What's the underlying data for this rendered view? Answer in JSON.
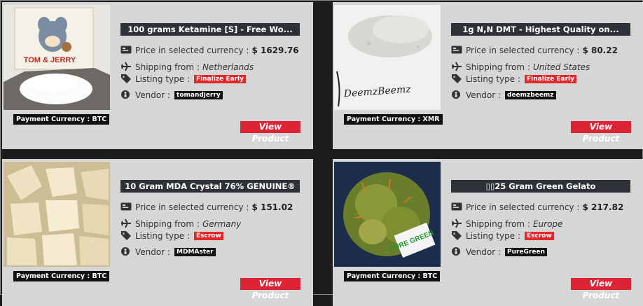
{
  "labels": {
    "price": "Price in selected currency :",
    "shipping": "Shipping from :",
    "listing": "Listing type :",
    "vendor": "Vendor :",
    "view": "View Product"
  },
  "products": [
    {
      "title": "100 grams Ketamine [S] - Free Wo...",
      "price": "$ 1629.76",
      "shipping_from": "Netherlands",
      "listing_type": "Finalize Early",
      "vendor": "tomandjerry",
      "payment": "Payment Currency : BTC",
      "image_logo_text": "TOM & JERRY"
    },
    {
      "title": "1g N,N DMT - Highest Quality on...",
      "price": "$ 80.22",
      "shipping_from": "United States",
      "listing_type": "Finalize Early",
      "vendor": "deemzbeemz",
      "payment": "Payment Currency : XMR",
      "image_logo_text": "DeemzBeemz"
    },
    {
      "title": "10 Gram MDA Crystal 76% GENUINE®",
      "price": "$ 151.02",
      "shipping_from": "Germany",
      "listing_type": "Escrow",
      "vendor": "MDMAster",
      "payment": "Payment Currency : BTC"
    },
    {
      "title": "▯▯25 Gram Green Gelato",
      "price": "$ 217.82",
      "shipping_from": "Europe",
      "listing_type": "Escrow",
      "vendor": "PureGreen",
      "payment": "Payment Currency : BTC",
      "image_logo_text": "PURE GREEN"
    }
  ],
  "colors": {
    "card_bg": "#d6d6d6",
    "title_bar": "#2e3238",
    "accent_red": "#dc2434",
    "page_bg": "#1c1c1c"
  }
}
